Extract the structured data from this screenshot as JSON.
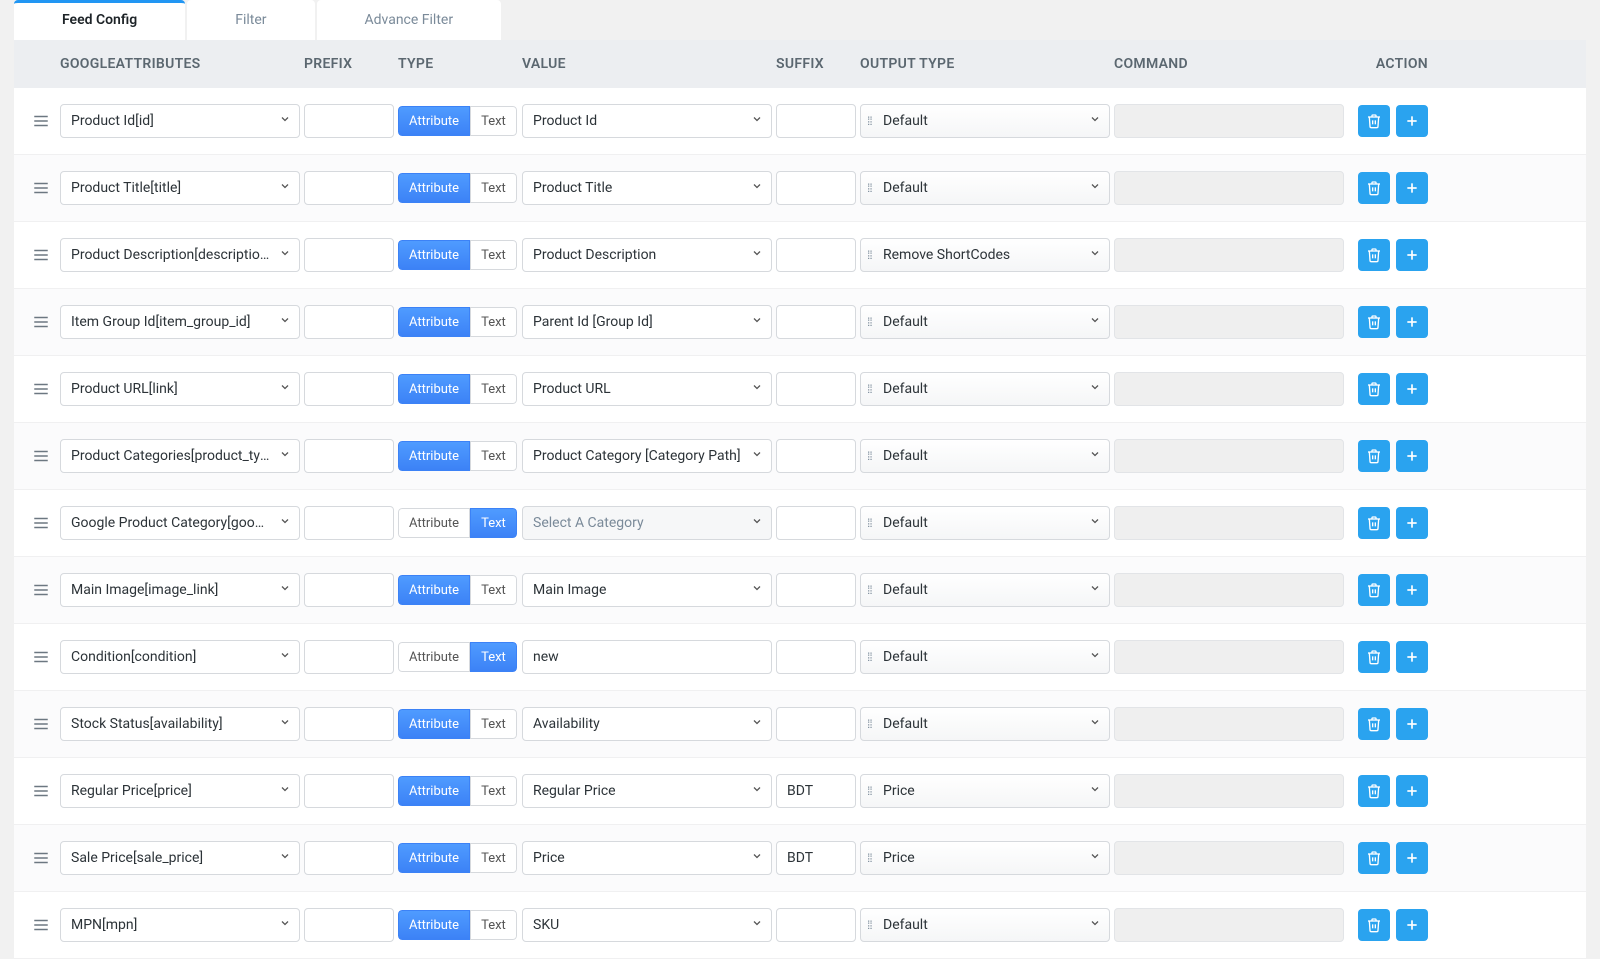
{
  "tabs": {
    "feed_config": "Feed Config",
    "filter": "Filter",
    "advance_filter": "Advance Filter"
  },
  "columns": {
    "attributes": "GOOGLEATTRIBUTES",
    "prefix": "PREFIX",
    "type": "TYPE",
    "value": "VALUE",
    "suffix": "SUFFIX",
    "output_type": "OUTPUT TYPE",
    "command": "COMMAND",
    "action": "ACTION"
  },
  "type_labels": {
    "attribute": "Attribute",
    "text": "Text"
  },
  "value_placeholder": "Select A Category",
  "rows": [
    {
      "attribute": "Product Id[id]",
      "prefix": "",
      "type_selected": "attribute",
      "value": "Product Id",
      "value_is_select": true,
      "suffix": "",
      "output_type": "Default",
      "command": ""
    },
    {
      "attribute": "Product Title[title]",
      "prefix": "",
      "type_selected": "attribute",
      "value": "Product Title",
      "value_is_select": true,
      "suffix": "",
      "output_type": "Default",
      "command": ""
    },
    {
      "attribute": "Product Description[description]",
      "prefix": "",
      "type_selected": "attribute",
      "value": "Product Description",
      "value_is_select": true,
      "suffix": "",
      "output_type": "Remove ShortCodes",
      "command": ""
    },
    {
      "attribute": "Item Group Id[item_group_id]",
      "prefix": "",
      "type_selected": "attribute",
      "value": "Parent Id [Group Id]",
      "value_is_select": true,
      "suffix": "",
      "output_type": "Default",
      "command": ""
    },
    {
      "attribute": "Product URL[link]",
      "prefix": "",
      "type_selected": "attribute",
      "value": "Product URL",
      "value_is_select": true,
      "suffix": "",
      "output_type": "Default",
      "command": ""
    },
    {
      "attribute": "Product Categories[product_type]",
      "prefix": "",
      "type_selected": "attribute",
      "value": "Product Category [Category Path]",
      "value_is_select": true,
      "suffix": "",
      "output_type": "Default",
      "command": ""
    },
    {
      "attribute": "Google Product Category[google_product_category]",
      "prefix": "",
      "type_selected": "text",
      "value": "",
      "value_is_select": true,
      "value_placeholder": true,
      "suffix": "",
      "output_type": "Default",
      "command": ""
    },
    {
      "attribute": "Main Image[image_link]",
      "prefix": "",
      "type_selected": "attribute",
      "value": "Main Image",
      "value_is_select": true,
      "suffix": "",
      "output_type": "Default",
      "command": ""
    },
    {
      "attribute": "Condition[condition]",
      "prefix": "",
      "type_selected": "text",
      "value": "new",
      "value_is_select": false,
      "suffix": "",
      "output_type": "Default",
      "command": ""
    },
    {
      "attribute": "Stock Status[availability]",
      "prefix": "",
      "type_selected": "attribute",
      "value": "Availability",
      "value_is_select": true,
      "suffix": "",
      "output_type": "Default",
      "command": ""
    },
    {
      "attribute": "Regular Price[price]",
      "prefix": "",
      "type_selected": "attribute",
      "value": "Regular Price",
      "value_is_select": true,
      "suffix": "BDT",
      "output_type": "Price",
      "command": ""
    },
    {
      "attribute": "Sale Price[sale_price]",
      "prefix": "",
      "type_selected": "attribute",
      "value": "Price",
      "value_is_select": true,
      "suffix": "BDT",
      "output_type": "Price",
      "command": ""
    },
    {
      "attribute": "MPN[mpn]",
      "prefix": "",
      "type_selected": "attribute",
      "value": "SKU",
      "value_is_select": true,
      "suffix": "",
      "output_type": "Default",
      "command": ""
    }
  ]
}
